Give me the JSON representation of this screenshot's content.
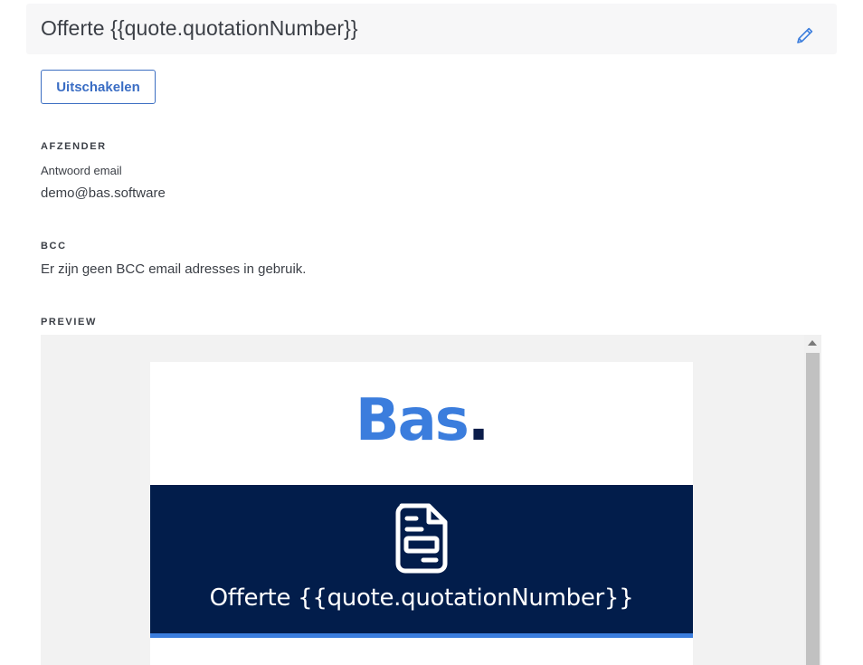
{
  "header": {
    "title": "Offerte {{quote.quotationNumber}}",
    "edit_icon": "pencil-icon"
  },
  "actions": {
    "toggle_label": "Uitschakelen"
  },
  "sender": {
    "label": "AFZENDER",
    "reply_label": "Antwoord email",
    "reply_value": "demo@bas.software"
  },
  "bcc": {
    "label": "BCC",
    "value": "Er zijn geen BCC email adresses in gebruik."
  },
  "preview": {
    "label": "PREVIEW",
    "logo_text": "Bas",
    "logo_dot": ".",
    "banner_icon": "document-icon",
    "banner_title": "Offerte {{quote.quotationNumber}}"
  },
  "colors": {
    "accent": "#3b7ddd",
    "banner_bg": "#021d4b",
    "button_text": "#3a6dc4"
  }
}
